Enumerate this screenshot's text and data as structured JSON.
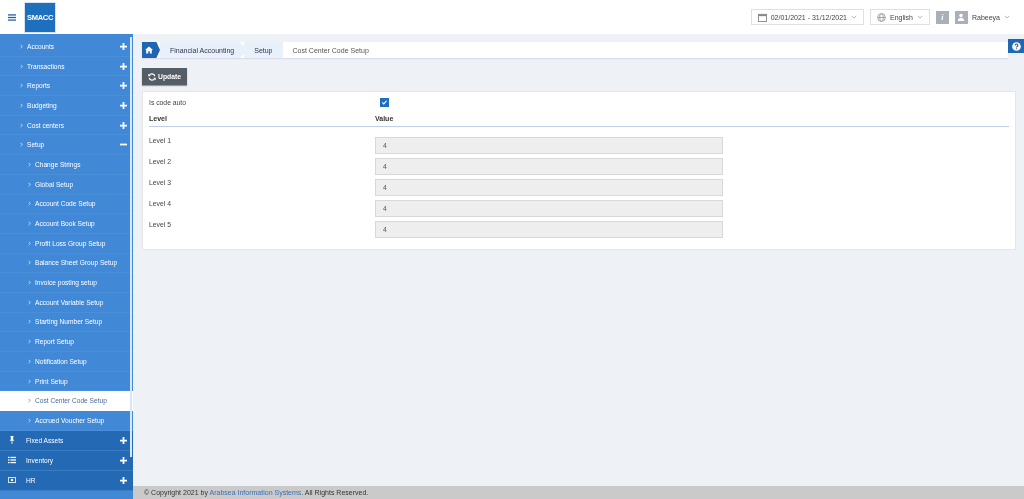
{
  "header": {
    "logo": "SMACC",
    "date_range": "02/01/2021 - 31/12/2021",
    "language": "English",
    "info": "i",
    "user": "Rabeeya"
  },
  "sidebar": {
    "items": [
      {
        "kind": "group",
        "label": "Accounts",
        "expanded": false
      },
      {
        "kind": "group",
        "label": "Transactions",
        "expanded": false
      },
      {
        "kind": "group",
        "label": "Reports",
        "expanded": false
      },
      {
        "kind": "group",
        "label": "Budgeting",
        "expanded": false
      },
      {
        "kind": "group",
        "label": "Cost centers",
        "expanded": false
      },
      {
        "kind": "group",
        "label": "Setup",
        "expanded": true,
        "children": [
          {
            "label": "Change Strings",
            "selected": false
          },
          {
            "label": "Global Setup",
            "selected": false
          },
          {
            "label": "Account Code Setup",
            "selected": false
          },
          {
            "label": "Account Book Setup",
            "selected": false
          },
          {
            "label": "Profit Loss Group Setup",
            "selected": false
          },
          {
            "label": "Balance Sheet Group Setup",
            "selected": false
          },
          {
            "label": "Invoice posting setup",
            "selected": false
          },
          {
            "label": "Account Variable Setup",
            "selected": false
          },
          {
            "label": "Starting Number Setup",
            "selected": false
          },
          {
            "label": "Report Setup",
            "selected": false
          },
          {
            "label": "Notification Setup",
            "selected": false
          },
          {
            "label": "Print Setup",
            "selected": false
          },
          {
            "label": "Cost Center Code Setup",
            "selected": true
          },
          {
            "label": "Accrued Voucher Setup",
            "selected": false
          }
        ]
      },
      {
        "kind": "module",
        "label": "Fixed Assets",
        "expanded": false
      },
      {
        "kind": "module",
        "label": "Inventory",
        "expanded": false
      },
      {
        "kind": "module",
        "label": "HR",
        "expanded": false
      }
    ]
  },
  "breadcrumb": [
    "Financial Accounting",
    "Setup",
    "Cost Center Code Setup"
  ],
  "update_button": "Update",
  "form": {
    "auto_label": "Is code auto",
    "auto_checked": true,
    "columns": [
      "Level",
      "Value"
    ],
    "rows": [
      {
        "label": "Level 1",
        "value": "4"
      },
      {
        "label": "Level 2",
        "value": "4"
      },
      {
        "label": "Level 3",
        "value": "4"
      },
      {
        "label": "Level 4",
        "value": "4"
      },
      {
        "label": "Level 5",
        "value": "4"
      }
    ]
  },
  "footer": {
    "prefix": "© Copyright 2021 by ",
    "link": "Arabsea Information Systems",
    "suffix": ". All Rights Reserved."
  }
}
